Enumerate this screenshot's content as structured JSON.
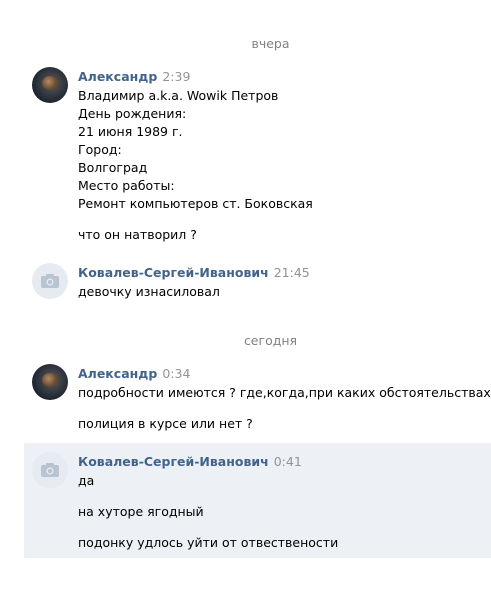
{
  "separators": {
    "yesterday": "вчера",
    "today": "сегодня"
  },
  "messages": [
    {
      "author": "Александр",
      "time": "2:39",
      "lines": [
        "Владимир a.k.a. Wowik Петров",
        "День рождения:",
        "21 июня 1989 г.",
        "Город:",
        "Волгоград",
        "Место работы:",
        "Ремонт компьютеров ст. Боковская",
        "что он натворил ?"
      ]
    },
    {
      "author": "Ковалев-Сергей-Иванович",
      "time": "21:45",
      "lines": [
        "девочку изнасиловал"
      ]
    },
    {
      "author": "Александр",
      "time": "0:34",
      "lines": [
        "подробности имеются ? где,когда,при каких обстоятельствах",
        "полиция в курсе или нет ?"
      ]
    },
    {
      "author": "Ковалев-Сергей-Иванович",
      "time": "0:41",
      "lines": [
        "да",
        "на хуторе ягодный",
        "подонку удлось уйти от отвествености"
      ]
    }
  ],
  "colors": {
    "author": "#42648b",
    "time": "#939393",
    "separator": "#828282",
    "highlight": "#edf0f5",
    "avatar_placeholder": "#e5ebf1"
  },
  "icons": {
    "placeholder_avatar": "camera-icon"
  }
}
